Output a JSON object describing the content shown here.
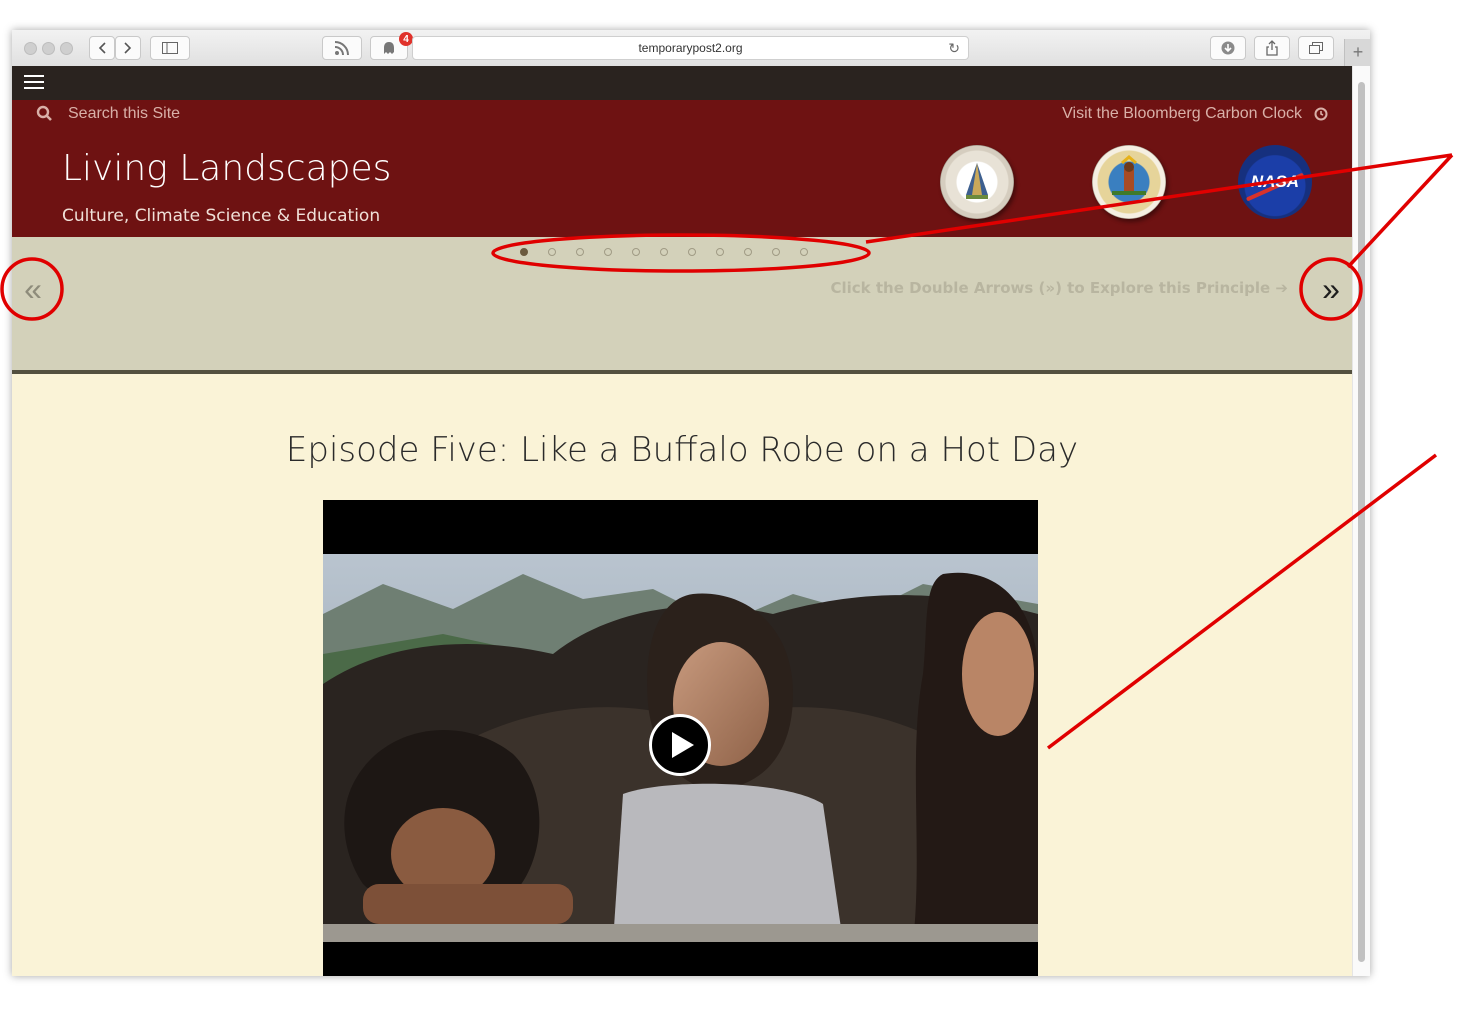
{
  "browser": {
    "url": "temporarypost2.org",
    "notification_count": "4",
    "icons": [
      "back-icon",
      "forward-icon",
      "sidebar-icon",
      "rss-icon",
      "ghostery-icon",
      "reload-icon",
      "download-icon",
      "share-icon",
      "tabs-icon",
      "new-tab-icon"
    ]
  },
  "header": {
    "search_label": "Search this Site",
    "carbon_link": "Visit the Bloomberg Carbon Clock",
    "title": "Living Landscapes",
    "subtitle": "Culture, Climate Science & Education",
    "logos": [
      "tribal-college-seal",
      "confederated-tribes-seal",
      "nasa-logo"
    ],
    "logo_text": {
      "nasa": "NASA"
    }
  },
  "principle_band": {
    "dot_count": 11,
    "active_dot": 0,
    "explore_text": "Click the Double Arrows (») to Explore this Principle ➔",
    "prev_symbol": "«",
    "next_symbol": "»"
  },
  "content": {
    "episode_title": "Episode Five: Like a Buffalo Robe on a Hot Day"
  },
  "colors": {
    "header_bg": "#6e1212",
    "topbar_bg": "#2a231f",
    "band_bg": "#d3d1ba",
    "page_bg": "#faf3d7",
    "annotation": "#e00000"
  }
}
